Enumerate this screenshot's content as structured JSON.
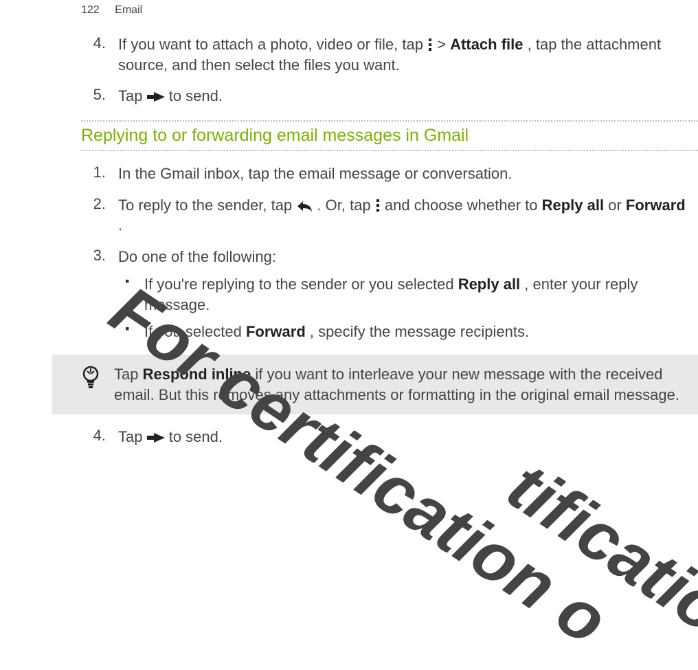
{
  "header": {
    "page_number": "122",
    "title": "Email"
  },
  "step4": {
    "num": "4.",
    "pre": "If you want to attach a photo, video or file, tap ",
    "mid": " > ",
    "bold": "Attach file",
    "post": ", tap the attachment source, and then select the files you want."
  },
  "step5": {
    "num": "5.",
    "pre": "Tap ",
    "post": " to send."
  },
  "section_heading": "Replying to or forwarding email messages in Gmail",
  "r1": {
    "num": "1.",
    "text": "In the Gmail inbox, tap the email message or conversation."
  },
  "r2": {
    "num": "2.",
    "a": "To reply to the sender, tap ",
    "b": ". Or, tap ",
    "c": " and choose whether to ",
    "bold1": "Reply all",
    "d": " or ",
    "bold2": "Forward",
    "e": "."
  },
  "r3": {
    "num": "3.",
    "text": "Do one of the following:"
  },
  "bul1": {
    "a": "If you're replying to the sender or you selected ",
    "bold": "Reply all",
    "b": ", enter your reply message."
  },
  "bul2": {
    "a": "If you selected ",
    "bold": "Forward",
    "b": ", specify the message recipients."
  },
  "tip": {
    "a": "Tap ",
    "bold": "Respond inline",
    "b": " if you want to interleave your new message with the received email. But this removes any attachments or formatting in the original email message."
  },
  "r4": {
    "num": "4.",
    "pre": "Tap ",
    "post": " to send."
  },
  "watermarks": {
    "w2": "For certification o",
    "w3": "tificatio"
  },
  "icons": {
    "overflow": "overflow-menu-icon",
    "send": "send-icon",
    "reply": "reply-icon",
    "tip": "lightbulb-icon"
  }
}
